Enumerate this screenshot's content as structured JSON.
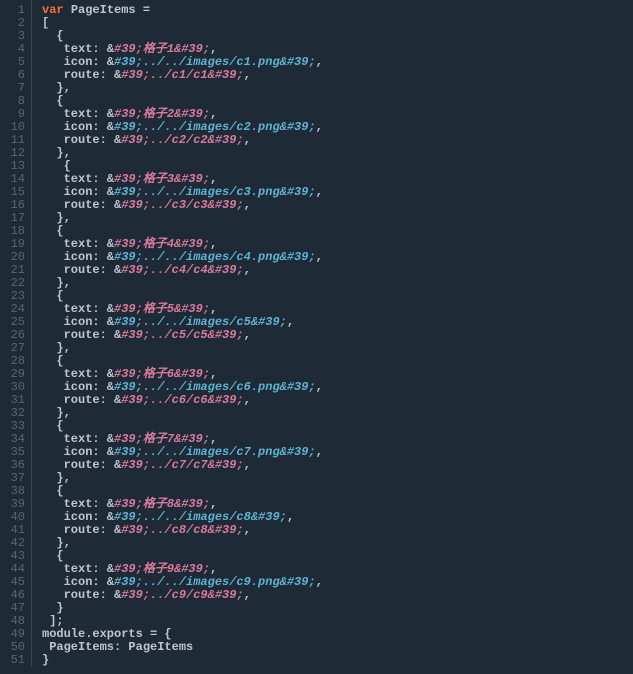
{
  "gutter": {
    "start": 1,
    "end": 51
  },
  "code": {
    "lines": [
      {
        "tokens": [
          {
            "t": "var ",
            "c": "kw-var"
          },
          {
            "t": "PageItems =",
            "c": "plain"
          }
        ]
      },
      {
        "tokens": [
          {
            "t": "[",
            "c": "plain"
          }
        ]
      },
      {
        "tokens": [
          {
            "t": "  {",
            "c": "plain"
          }
        ]
      },
      {
        "tokens": [
          {
            "t": "   text: &",
            "c": "plain"
          },
          {
            "t": "#39;格子1&#39;",
            "c": "str-pink"
          },
          {
            "t": ",",
            "c": "plain"
          }
        ]
      },
      {
        "tokens": [
          {
            "t": "   icon: &",
            "c": "plain"
          },
          {
            "t": "#39;../../images/c1.png&#39;",
            "c": "str-blue"
          },
          {
            "t": ",",
            "c": "plain"
          }
        ]
      },
      {
        "tokens": [
          {
            "t": "   route: &",
            "c": "plain"
          },
          {
            "t": "#39;../c1/c1&#39;",
            "c": "str-pink"
          },
          {
            "t": ",",
            "c": "plain"
          }
        ]
      },
      {
        "tokens": [
          {
            "t": "  },",
            "c": "plain"
          }
        ]
      },
      {
        "tokens": [
          {
            "t": "  {",
            "c": "plain"
          }
        ]
      },
      {
        "tokens": [
          {
            "t": "   text: &",
            "c": "plain"
          },
          {
            "t": "#39;格子2&#39;",
            "c": "str-pink"
          },
          {
            "t": ",",
            "c": "plain"
          }
        ]
      },
      {
        "tokens": [
          {
            "t": "   icon: &",
            "c": "plain"
          },
          {
            "t": "#39;../../images/c2.png&#39;",
            "c": "str-blue"
          },
          {
            "t": ",",
            "c": "plain"
          }
        ]
      },
      {
        "tokens": [
          {
            "t": "   route: &",
            "c": "plain"
          },
          {
            "t": "#39;../c2/c2&#39;",
            "c": "str-pink"
          },
          {
            "t": ",",
            "c": "plain"
          }
        ]
      },
      {
        "tokens": [
          {
            "t": "  },",
            "c": "plain"
          }
        ]
      },
      {
        "tokens": [
          {
            "t": "   {",
            "c": "plain"
          }
        ]
      },
      {
        "tokens": [
          {
            "t": "   text: &",
            "c": "plain"
          },
          {
            "t": "#39;格子3&#39;",
            "c": "str-pink"
          },
          {
            "t": ",",
            "c": "plain"
          }
        ]
      },
      {
        "tokens": [
          {
            "t": "   icon: &",
            "c": "plain"
          },
          {
            "t": "#39;../../images/c3.png&#39;",
            "c": "str-blue"
          },
          {
            "t": ",",
            "c": "plain"
          }
        ]
      },
      {
        "tokens": [
          {
            "t": "   route: &",
            "c": "plain"
          },
          {
            "t": "#39;../c3/c3&#39;",
            "c": "str-pink"
          },
          {
            "t": ",",
            "c": "plain"
          }
        ]
      },
      {
        "tokens": [
          {
            "t": "  },",
            "c": "plain"
          }
        ]
      },
      {
        "tokens": [
          {
            "t": "  {",
            "c": "plain"
          }
        ]
      },
      {
        "tokens": [
          {
            "t": "   text: &",
            "c": "plain"
          },
          {
            "t": "#39;格子4&#39;",
            "c": "str-pink"
          },
          {
            "t": ",",
            "c": "plain"
          }
        ]
      },
      {
        "tokens": [
          {
            "t": "   icon: &",
            "c": "plain"
          },
          {
            "t": "#39;../../images/c4.png&#39;",
            "c": "str-blue"
          },
          {
            "t": ",",
            "c": "plain"
          }
        ]
      },
      {
        "tokens": [
          {
            "t": "   route: &",
            "c": "plain"
          },
          {
            "t": "#39;../c4/c4&#39;",
            "c": "str-pink"
          },
          {
            "t": ",",
            "c": "plain"
          }
        ]
      },
      {
        "tokens": [
          {
            "t": "  },",
            "c": "plain"
          }
        ]
      },
      {
        "tokens": [
          {
            "t": "  {",
            "c": "plain"
          }
        ]
      },
      {
        "tokens": [
          {
            "t": "   text: &",
            "c": "plain"
          },
          {
            "t": "#39;格子5&#39;",
            "c": "str-pink"
          },
          {
            "t": ",",
            "c": "plain"
          }
        ]
      },
      {
        "tokens": [
          {
            "t": "   icon: &",
            "c": "plain"
          },
          {
            "t": "#39;../../images/c5&#39;",
            "c": "str-blue"
          },
          {
            "t": ",",
            "c": "plain"
          }
        ]
      },
      {
        "tokens": [
          {
            "t": "   route: &",
            "c": "plain"
          },
          {
            "t": "#39;../c5/c5&#39;",
            "c": "str-pink"
          },
          {
            "t": ",",
            "c": "plain"
          }
        ]
      },
      {
        "tokens": [
          {
            "t": "  },",
            "c": "plain"
          }
        ]
      },
      {
        "tokens": [
          {
            "t": "  {",
            "c": "plain"
          }
        ]
      },
      {
        "tokens": [
          {
            "t": "   text: &",
            "c": "plain"
          },
          {
            "t": "#39;格子6&#39;",
            "c": "str-pink"
          },
          {
            "t": ",",
            "c": "plain"
          }
        ]
      },
      {
        "tokens": [
          {
            "t": "   icon: &",
            "c": "plain"
          },
          {
            "t": "#39;../../images/c6.png&#39;",
            "c": "str-blue"
          },
          {
            "t": ",",
            "c": "plain"
          }
        ]
      },
      {
        "tokens": [
          {
            "t": "   route: &",
            "c": "plain"
          },
          {
            "t": "#39;../c6/c6&#39;",
            "c": "str-pink"
          },
          {
            "t": ",",
            "c": "plain"
          }
        ]
      },
      {
        "tokens": [
          {
            "t": "  },",
            "c": "plain"
          }
        ]
      },
      {
        "tokens": [
          {
            "t": "  {",
            "c": "plain"
          }
        ]
      },
      {
        "tokens": [
          {
            "t": "   text: &",
            "c": "plain"
          },
          {
            "t": "#39;格子7&#39;",
            "c": "str-pink"
          },
          {
            "t": ",",
            "c": "plain"
          }
        ]
      },
      {
        "tokens": [
          {
            "t": "   icon: &",
            "c": "plain"
          },
          {
            "t": "#39;../../images/c7.png&#39;",
            "c": "str-blue"
          },
          {
            "t": ",",
            "c": "plain"
          }
        ]
      },
      {
        "tokens": [
          {
            "t": "   route: &",
            "c": "plain"
          },
          {
            "t": "#39;../c7/c7&#39;",
            "c": "str-pink"
          },
          {
            "t": ",",
            "c": "plain"
          }
        ]
      },
      {
        "tokens": [
          {
            "t": "  },",
            "c": "plain"
          }
        ]
      },
      {
        "tokens": [
          {
            "t": "  {",
            "c": "plain"
          }
        ]
      },
      {
        "tokens": [
          {
            "t": "   text: &",
            "c": "plain"
          },
          {
            "t": "#39;格子8&#39;",
            "c": "str-pink"
          },
          {
            "t": ",",
            "c": "plain"
          }
        ]
      },
      {
        "tokens": [
          {
            "t": "   icon: &",
            "c": "plain"
          },
          {
            "t": "#39;../../images/c8&#39;",
            "c": "str-blue"
          },
          {
            "t": ",",
            "c": "plain"
          }
        ]
      },
      {
        "tokens": [
          {
            "t": "   route: &",
            "c": "plain"
          },
          {
            "t": "#39;../c8/c8&#39;",
            "c": "str-pink"
          },
          {
            "t": ",",
            "c": "plain"
          }
        ]
      },
      {
        "tokens": [
          {
            "t": "  },",
            "c": "plain"
          }
        ]
      },
      {
        "tokens": [
          {
            "t": "  {",
            "c": "plain"
          }
        ]
      },
      {
        "tokens": [
          {
            "t": "   text: &",
            "c": "plain"
          },
          {
            "t": "#39;格子9&#39;",
            "c": "str-pink"
          },
          {
            "t": ",",
            "c": "plain"
          }
        ]
      },
      {
        "tokens": [
          {
            "t": "   icon: &",
            "c": "plain"
          },
          {
            "t": "#39;../../images/c9.png&#39;",
            "c": "str-blue"
          },
          {
            "t": ",",
            "c": "plain"
          }
        ]
      },
      {
        "tokens": [
          {
            "t": "   route: &",
            "c": "plain"
          },
          {
            "t": "#39;../c9/c9&#39;",
            "c": "str-pink"
          },
          {
            "t": ",",
            "c": "plain"
          }
        ]
      },
      {
        "tokens": [
          {
            "t": "  }",
            "c": "plain"
          }
        ]
      },
      {
        "tokens": [
          {
            "t": " ];",
            "c": "plain"
          }
        ]
      },
      {
        "tokens": [
          {
            "t": "module.exports = {",
            "c": "plain"
          }
        ]
      },
      {
        "tokens": [
          {
            "t": " PageItems: PageItems",
            "c": "plain"
          }
        ]
      },
      {
        "tokens": [
          {
            "t": "}",
            "c": "plain"
          }
        ]
      }
    ]
  }
}
